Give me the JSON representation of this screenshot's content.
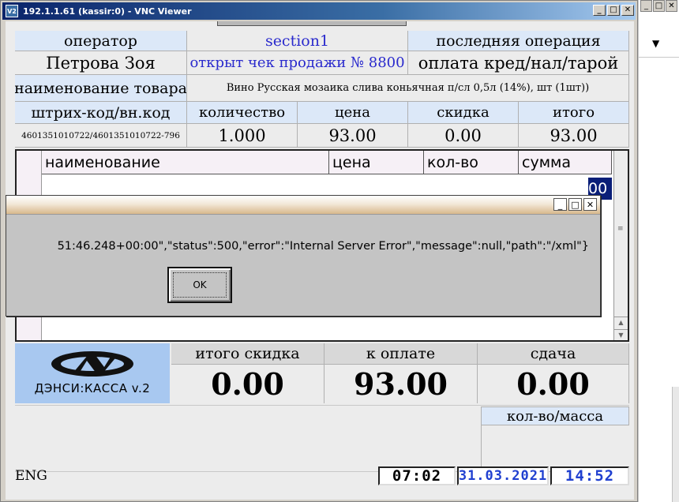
{
  "vnc": {
    "title": "192.1.1.61 (kassir:0) - VNC Viewer",
    "logo": "V2",
    "btn_min": "_",
    "btn_max": "□",
    "btn_close": "✕"
  },
  "bg_window": {
    "btn_min": "_",
    "btn_max": "□",
    "btn_close": "✕",
    "dropdown_icon": "▼"
  },
  "info": {
    "operator_label": "оператор",
    "section": "section1",
    "last_op_label": "последняя операция",
    "operator_name": "Петрова Зоя",
    "check_status": "открыт чек продажи № 8800",
    "last_op_value": "оплата кред/нал/тарой",
    "product_label": "наименование товара",
    "product_name": "Вино Русская мозаика слива коньячная п/сл 0,5л (14%), шт (1шт))",
    "barcode_label": "штрих-код/вн.код",
    "qty_label": "количество",
    "price_label": "цена",
    "discount_label": "скидка",
    "total_label": "итого",
    "barcode_value": "4601351010722/4601351010722-796",
    "qty_value": "1.000",
    "price_value": "93.00",
    "discount_value": "0.00",
    "total_value": "93.00"
  },
  "table": {
    "columns": [
      "наименование",
      "цена",
      "кол-во",
      "сумма"
    ],
    "selected_fragment": "00",
    "scroll_grip": "≡",
    "scroll_up": "▲",
    "scroll_down": "▼"
  },
  "totals": {
    "logo_text": "ДЭНСИ:КАССА v.2",
    "discount_label": "итого скидка",
    "discount_value": "0.00",
    "to_pay_label": "к оплате",
    "to_pay_value": "93.00",
    "change_label": "сдача",
    "change_value": "0.00",
    "qty_mass_label": "кол-во/масса"
  },
  "status": {
    "language": "ENG",
    "counter": "07:02",
    "date": "31.03.2021",
    "time": "14:52"
  },
  "dialog": {
    "btn_min": "_",
    "btn_max": "□",
    "btn_close": "✕",
    "message": "51:46.248+00:00\",\"status\":500,\"error\":\"Internal Server Error\",\"message\":null,\"path\":\"/xml\"}",
    "ok_label": "OK"
  },
  "colors": {
    "header_bg": "#dce8f8",
    "selected_row": "#0a1e78",
    "logo_bg": "#a8c8f0",
    "clock_text": "#2040d0",
    "status_blue": "#2a2acd"
  }
}
